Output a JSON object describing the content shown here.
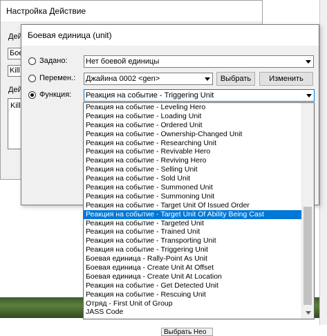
{
  "background_window": {
    "title": "Настройка Действие",
    "labels": [
      "Дей",
      "Дей"
    ],
    "fields": [
      "Боев",
      "Kill"
    ],
    "box_text": "Kill"
  },
  "dialog": {
    "title": "Боевая единица (unit)",
    "preset": {
      "label": "Задано:",
      "value": "Нет боевой единицы"
    },
    "variable": {
      "label": "Перемен.:",
      "value": "Джайина 0002 <gen>",
      "select_label": "Выбрать",
      "edit_label": "Изменить"
    },
    "function": {
      "label": "Функция:",
      "value": "Реакция на событие - Triggering Unit",
      "selected": true
    }
  },
  "dropdown": {
    "items": [
      "Реакция на событие - Leveling Hero",
      "Реакция на событие - Loading Unit",
      "Реакция на событие - Ordered Unit",
      "Реакция на событие - Ownership-Changed Unit",
      "Реакция на событие - Researching Unit",
      "Реакция на событие - Revivable Hero",
      "Реакция на событие - Reviving Hero",
      "Реакция на событие - Selling Unit",
      "Реакция на событие - Sold Unit",
      "Реакция на событие - Summoned Unit",
      "Реакция на событие - Summoning Unit",
      "Реакция на событие - Target Unit Of Issued Order",
      "Реакция на событие - Target Unit Of Ability Being Cast",
      "Реакция на событие - Targeted Unit",
      "Реакция на событие - Trained Unit",
      "Реакция на событие - Transporting Unit",
      "Реакция на событие - Triggering Unit",
      "Боевая единица - Rally-Point As Unit",
      "Боевая единица - Create Unit At Offset",
      "Боевая единица - Create Unit At Location",
      "Реакция на событие - Get Detected Unit",
      "Реакция на событие - Rescuing Unit",
      "Отряд - First Unit of Group",
      "JASS Code"
    ],
    "selected_index": 12
  },
  "bottom_button": {
    "label": "Выбрать Нео"
  },
  "colors": {
    "selection": "#0078d7",
    "dialog_bg": "#f0f0f0"
  }
}
